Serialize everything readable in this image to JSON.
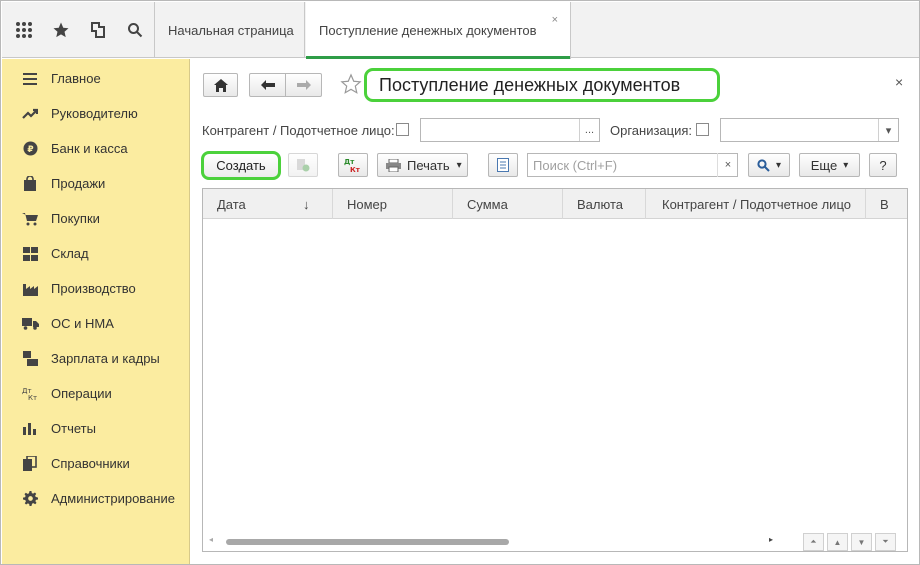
{
  "topbar": {
    "icons": [
      "apps-grid-icon",
      "star-icon",
      "history-icon",
      "search-icon"
    ],
    "tabs": [
      {
        "label": "Начальная страница"
      },
      {
        "label": "Поступление денежных документов",
        "close": "×"
      }
    ]
  },
  "sidebar": {
    "items": [
      {
        "label": "Главное",
        "icon": "menu-lines-icon"
      },
      {
        "label": "Руководителю",
        "icon": "trend-up-icon"
      },
      {
        "label": "Банк и касса",
        "icon": "ruble-coin-icon"
      },
      {
        "label": "Продажи",
        "icon": "shopping-bag-icon"
      },
      {
        "label": "Покупки",
        "icon": "cart-icon"
      },
      {
        "label": "Склад",
        "icon": "warehouse-icon"
      },
      {
        "label": "Производство",
        "icon": "factory-icon"
      },
      {
        "label": "ОС и НМА",
        "icon": "truck-icon"
      },
      {
        "label": "Зарплата и кадры",
        "icon": "people-icon"
      },
      {
        "label": "Операции",
        "icon": "dt-kt-icon"
      },
      {
        "label": "Отчеты",
        "icon": "bar-chart-icon"
      },
      {
        "label": "Справочники",
        "icon": "books-icon"
      },
      {
        "label": "Администрирование",
        "icon": "gear-icon"
      }
    ]
  },
  "form": {
    "title": "Поступление денежных документов",
    "close": "×",
    "filters": {
      "counterparty_label": "Контрагент / Подотчетное лицо:",
      "counterparty_btn": "...",
      "org_label": "Организация:"
    },
    "toolbar": {
      "create": "Создать",
      "dt_kt_top": "Дт",
      "dt_kt_bottom": "Кт",
      "print": "Печать",
      "search_placeholder": "Поиск (Ctrl+F)",
      "search_clear": "×",
      "more": "Еще",
      "help": "?"
    },
    "table": {
      "columns": [
        "Дата",
        "Номер",
        "Сумма",
        "Валюта",
        "Контрагент / Подотчетное лицо",
        "В"
      ],
      "sort_indicator": "↓",
      "rows": []
    }
  },
  "colors": {
    "sidebar_bg": "#fbeca0",
    "highlight": "#4bd13b",
    "active_tab_underline": "#2e9d47"
  }
}
